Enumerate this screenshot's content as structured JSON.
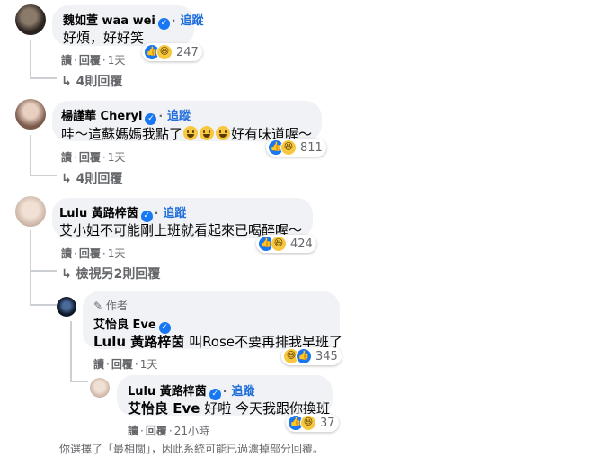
{
  "comments": [
    {
      "author": "魏如萱 waa wei",
      "follow": "追蹤",
      "text": "好煩，好好笑",
      "actions": {
        "read": "讀",
        "reply": "回覆",
        "time": "1天"
      },
      "reactions": {
        "count": "247"
      },
      "replies_link": "4則回覆"
    },
    {
      "author": "楊謹華 Cheryl",
      "follow": "追蹤",
      "text_before": "哇～這蘇媽媽我點了",
      "text_after": "好有味道喔～",
      "actions": {
        "read": "讀",
        "reply": "回覆",
        "time": "1天"
      },
      "reactions": {
        "count": "811"
      },
      "replies_link": "4則回覆"
    },
    {
      "author": "Lulu 黃路梓茵",
      "follow": "追蹤",
      "text": "艾小姐不可能剛上班就看起來已喝醉喔～",
      "actions": {
        "read": "讀",
        "reply": "回覆",
        "time": "1天"
      },
      "reactions": {
        "count": "424"
      },
      "replies_link": "檢視另2則回覆"
    }
  ],
  "replies": [
    {
      "badge": "作者",
      "author": "艾怡良 Eve",
      "mention": "Lulu 黃路梓茵",
      "text": "叫Rose不要再排我早班了",
      "actions": {
        "read": "讀",
        "reply": "回覆",
        "time": "1天"
      },
      "reactions": {
        "count": "345"
      }
    },
    {
      "author": "Lulu 黃路梓茵",
      "follow": "追蹤",
      "mention": "艾怡良 Eve",
      "text": "好啦 今天我跟你換班",
      "actions": {
        "read": "讀",
        "reply": "回覆",
        "time": "21小時"
      },
      "reactions": {
        "count": "37"
      }
    }
  ],
  "footer_note": "你選擇了「最相關」，因此系統可能已過濾掉部分回覆。",
  "colors": {
    "accent": "#216fdb",
    "bubble": "#f0f2f5",
    "muted": "#65676b"
  },
  "icons": [
    "verified-icon",
    "like-reaction-icon",
    "haha-reaction-icon",
    "reply-arrow-icon",
    "pencil-icon"
  ]
}
